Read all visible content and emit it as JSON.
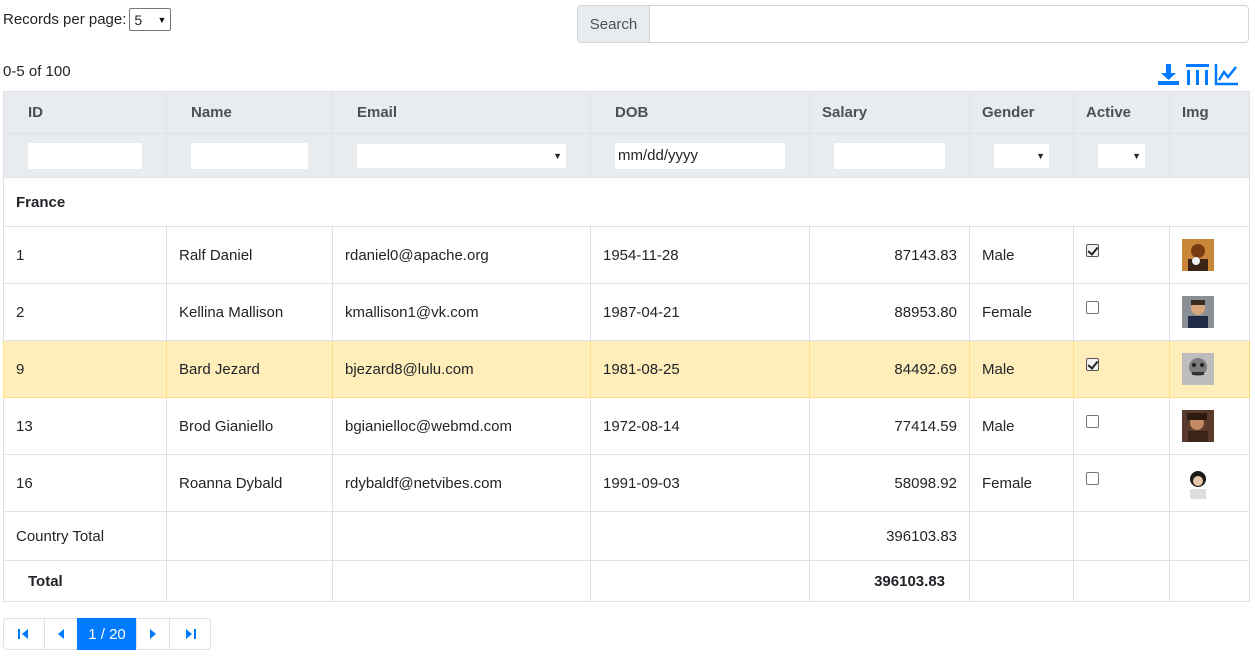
{
  "top": {
    "records_label": "Records per page:",
    "records_value": "5",
    "search_label": "Search",
    "search_value": ""
  },
  "range_text": "0-5 of 100",
  "toolbar": {
    "icons": [
      "download-icon",
      "columns-icon",
      "chart-icon"
    ],
    "accent": "#007bff"
  },
  "columns": [
    "ID",
    "Name",
    "Email",
    "DOB",
    "Salary",
    "Gender",
    "Active",
    "Img"
  ],
  "filters": {
    "id": "",
    "name": "",
    "email": "",
    "dob_placeholder": "mm/dd/yyyy",
    "salary": "",
    "gender": "",
    "active": ""
  },
  "group": {
    "label": "France"
  },
  "rows": [
    {
      "id": "1",
      "name": "Ralf Daniel",
      "email": "rdaniel0@apache.org",
      "dob": "1954-11-28",
      "salary": "87143.83",
      "gender": "Male",
      "active": true,
      "selected": false
    },
    {
      "id": "2",
      "name": "Kellina Mallison",
      "email": "kmallison1@vk.com",
      "dob": "1987-04-21",
      "salary": "88953.80",
      "gender": "Female",
      "active": false,
      "selected": false
    },
    {
      "id": "9",
      "name": "Bard Jezard",
      "email": "bjezard8@lulu.com",
      "dob": "1981-08-25",
      "salary": "84492.69",
      "gender": "Male",
      "active": true,
      "selected": true
    },
    {
      "id": "13",
      "name": "Brod Gianiello",
      "email": "bgianielloc@webmd.com",
      "dob": "1972-08-14",
      "salary": "77414.59",
      "gender": "Male",
      "active": false,
      "selected": false
    },
    {
      "id": "16",
      "name": "Roanna Dybald",
      "email": "rdybaldf@netvibes.com",
      "dob": "1991-09-03",
      "salary": "58098.92",
      "gender": "Female",
      "active": false,
      "selected": false
    }
  ],
  "subtotal": {
    "label": "Country Total",
    "salary": "396103.83"
  },
  "total": {
    "label": "Total",
    "salary": "396103.83"
  },
  "pager": {
    "page_text": "1 / 20"
  },
  "colors": {
    "selected_row": "#ffeeba",
    "header_bg": "#e9ecef",
    "accent": "#007bff"
  }
}
